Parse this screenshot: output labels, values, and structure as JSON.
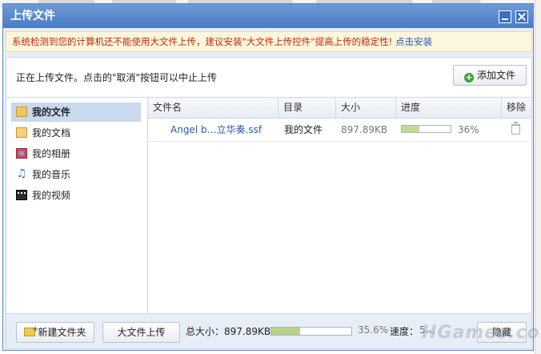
{
  "dialog": {
    "title": "上传文件",
    "notice_text": "系统检测到您的计算机还不能使用大文件上传，建议安装\"大文件上传控件\"提高上传的稳定性!",
    "notice_link": "点击安装",
    "status_message": "正在上传文件。点击的\"取消\"按钮可以中止上传",
    "add_file_label": "添加文件"
  },
  "sidebar": {
    "items": [
      {
        "label": "我的文件",
        "icon": "folder-icon",
        "active": true
      },
      {
        "label": "我的文档",
        "icon": "document-icon",
        "active": false
      },
      {
        "label": "我的相册",
        "icon": "album-icon",
        "active": false
      },
      {
        "label": "我的音乐",
        "icon": "music-icon",
        "active": false
      },
      {
        "label": "我的视频",
        "icon": "video-icon",
        "active": false
      }
    ]
  },
  "table": {
    "columns": [
      "文件名",
      "目录",
      "大小",
      "进度",
      "移除"
    ],
    "rows": [
      {
        "name": "Angel b…立华奏.ssf",
        "directory": "我的文件",
        "size": "897.89KB",
        "progress_percent": 36,
        "progress_text": "36%"
      }
    ]
  },
  "footer": {
    "new_folder_label": "新建文件夹",
    "large_upload_label": "大文件上传",
    "total_label": "总大小：897.89KB",
    "total_progress_percent": 35.6,
    "total_progress_text": "35.6%",
    "speed_label": "速度：",
    "speed_value": "5…",
    "hide_label": "隐藏"
  },
  "watermark": "HGames.com",
  "colors": {
    "title_bar": "#4a7cc6",
    "notice_text": "#c22a00",
    "link": "#1d5bb5",
    "progress_fill": "#c3d98e"
  }
}
